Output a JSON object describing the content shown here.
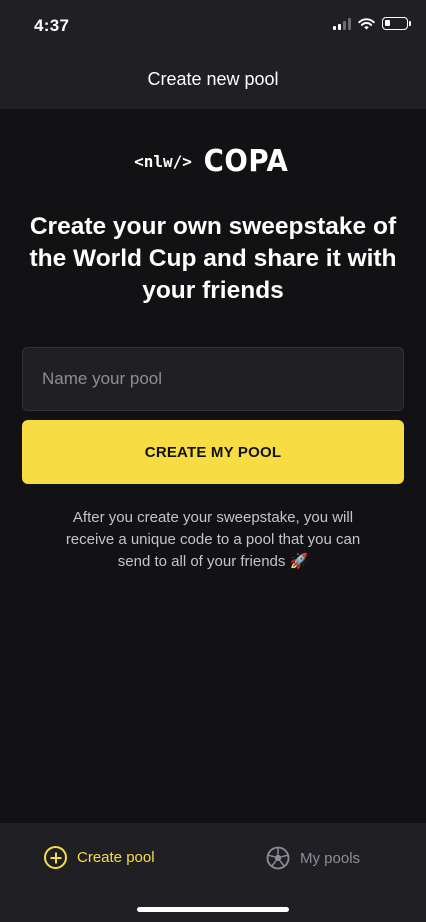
{
  "status_bar": {
    "time": "4:37"
  },
  "header": {
    "title": "Create new pool"
  },
  "logo": {
    "tag": "<nlw/>",
    "word": "COPA"
  },
  "headline": "Create your own sweepstake of the World Cup and share it with your friends",
  "pool_form": {
    "name_placeholder": "Name your pool",
    "name_value": "",
    "submit_label": "CREATE MY POOL"
  },
  "info_text": "After you create your sweepstake, you will receive a unique code to a pool that you can send to all of your friends 🚀",
  "tab_bar": {
    "create_label": "Create pool",
    "my_pools_label": "My pools",
    "active": "create"
  },
  "colors": {
    "background": "#121214",
    "surface": "#202024",
    "accent": "#F7DD43",
    "muted_text": "#8D8D99"
  },
  "icons": [
    "cellular-signal-icon",
    "wifi-icon",
    "battery-icon",
    "plus-circle-icon",
    "soccer-ball-icon"
  ]
}
